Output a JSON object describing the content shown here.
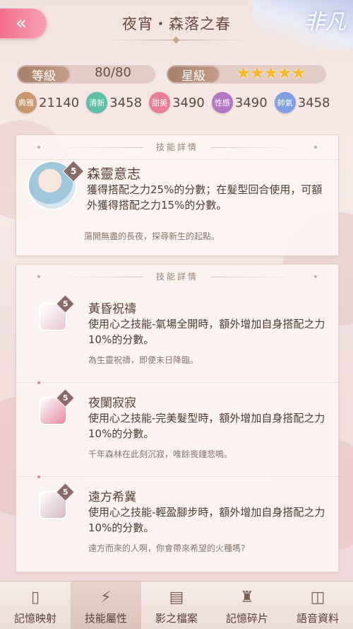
{
  "header": {
    "title": "夜宵・森落之春",
    "rarity": "非凡"
  },
  "stats": {
    "level_label": "等級",
    "level_value": "80/80",
    "star_label": "星級",
    "stars": 5,
    "attributes": [
      {
        "label": "典雅",
        "value": "21140",
        "color": "#c9976d"
      },
      {
        "label": "清新",
        "value": "3458",
        "color": "#5dbfa7"
      },
      {
        "label": "甜美",
        "value": "3490",
        "color": "#e97f95"
      },
      {
        "label": "性感",
        "value": "3490",
        "color": "#b278c4"
      },
      {
        "label": "帥氣",
        "value": "3458",
        "color": "#7f9fe0"
      }
    ]
  },
  "main_skill": {
    "header": "技能詳情",
    "rank": "5",
    "name": "森靈意志",
    "description": "獲得搭配之力25%的分數；在髮型回合使用，可額外獲得搭配之力15%的分數。",
    "flavor": "蕩開無盡的長夜，探尋新生的起點。"
  },
  "sub_skills_panel": {
    "header": "技能詳情",
    "skills": [
      {
        "rank": "5",
        "name": "黃昏祝禱",
        "description": "使用心之技能-氣場全開時，額外增加自身搭配之力10%的分數。",
        "flavor": "為生靈祝禱，即便末日降臨。",
        "icon_color": "#e9c9d3"
      },
      {
        "rank": "5",
        "name": "夜闌寂寂",
        "description": "使用心之技能-完美髮型時，額外增加自身搭配之力10%的分數。",
        "flavor": "千年森林在此刻沉寂，唯餘喪鐘悲鳴。",
        "icon_color": "#e58aa3"
      },
      {
        "rank": "5",
        "name": "遠方希冀",
        "description": "使用心之技能-輕盈腳步時，額外增加自身搭配之力10%的分數。",
        "flavor": "遠方而來的人啊，你會帶來希望的火種嗎?",
        "icon_color": "#d7b6c3"
      }
    ]
  },
  "bottom_nav": [
    {
      "label": "記憶映射",
      "icon": "card-icon",
      "active": false
    },
    {
      "label": "技能屬性",
      "icon": "lightning-icon",
      "active": true
    },
    {
      "label": "影之檔案",
      "icon": "document-icon",
      "active": false
    },
    {
      "label": "記憶碎片",
      "icon": "dress-icon",
      "active": false
    },
    {
      "label": "語音資料",
      "icon": "phone-audio-icon",
      "active": false
    }
  ]
}
